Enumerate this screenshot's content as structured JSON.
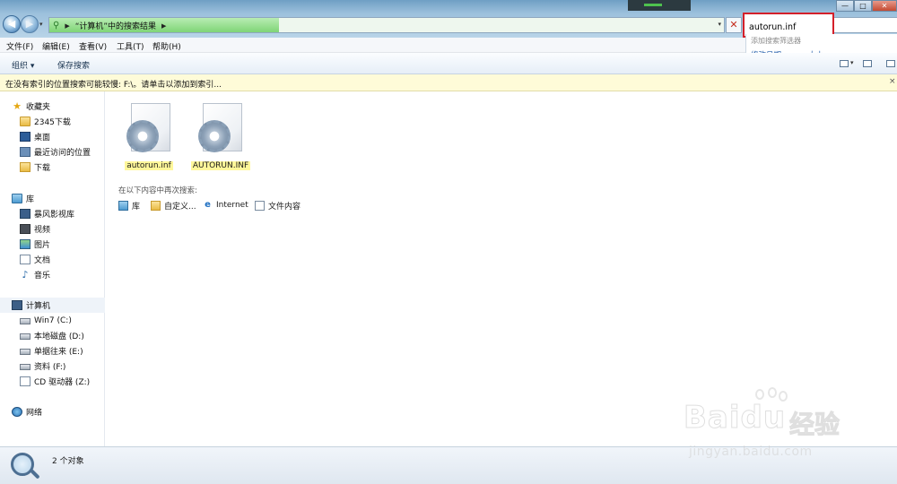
{
  "window": {
    "min_glyph": "—",
    "max_glyph": "□",
    "close_glyph": "✕"
  },
  "address": {
    "crumbs": [
      "“计算机”中的搜索结果"
    ],
    "back_glyph": "◀",
    "forward_glyph": "▶",
    "stop_glyph": "✕",
    "progress": 0.34
  },
  "search": {
    "value": "autorun.inf",
    "suggestion_title": "添加搜索筛选器",
    "filter_date": "修改日期:",
    "filter_size": "大小:"
  },
  "menu": {
    "items": [
      "文件(F)",
      "编辑(E)",
      "查看(V)",
      "工具(T)",
      "帮助(H)"
    ]
  },
  "commandbar": {
    "organize": "组织 ▾",
    "save_search": "保存搜索"
  },
  "infobar": {
    "text": "在没有索引的位置搜索可能较慢: F:\\。请单击以添加到索引...",
    "close": "×"
  },
  "nav": {
    "favorites": {
      "label": "收藏夹",
      "items": [
        "2345下载",
        "桌面",
        "最近访问的位置",
        "下载"
      ]
    },
    "libraries": {
      "label": "库",
      "items": [
        "暴风影视库",
        "视频",
        "图片",
        "文档",
        "音乐"
      ]
    },
    "computer": {
      "label": "计算机",
      "items": [
        "Win7 (C:)",
        "本地磁盘 (D:)",
        "单据往来 (E:)",
        "资料 (F:)",
        "CD 驱动器 (Z:)"
      ]
    },
    "network": {
      "label": "网络"
    }
  },
  "files": [
    {
      "name": "autorun.inf",
      "icon": "settings-file-icon"
    },
    {
      "name": "AUTORUN.INF",
      "icon": "settings-file-icon"
    }
  ],
  "search_again": {
    "label": "在以下内容中再次搜索:",
    "targets": [
      "库",
      "自定义...",
      "Internet",
      "文件内容"
    ]
  },
  "status": {
    "count": "2 个对象"
  },
  "watermark": {
    "brand": "Baidu",
    "cn": "经验",
    "url": "jingyan.baidu.com"
  },
  "colors": {
    "highlight_box": "#d4202a",
    "filename_highlight": "#fff79a",
    "infobar_bg": "#fefbd8",
    "link_blue": "#1e5aa8"
  }
}
